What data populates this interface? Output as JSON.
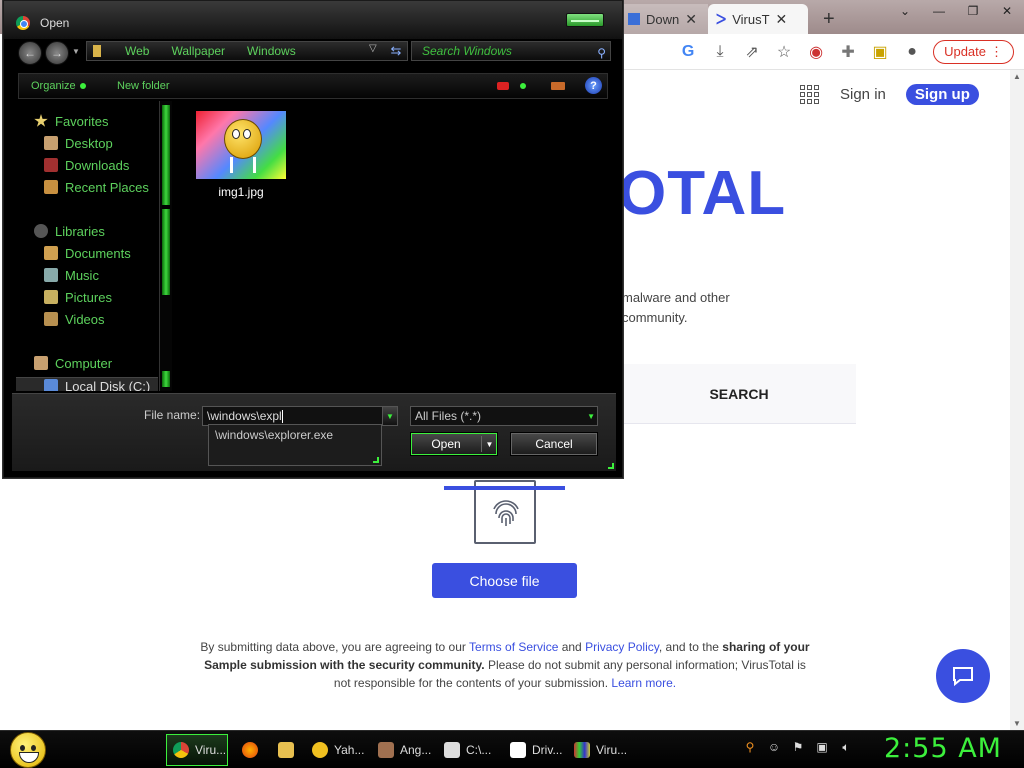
{
  "browser": {
    "tabs": [
      {
        "title": "Down"
      },
      {
        "title": "VirusT"
      }
    ],
    "new_tab": "+",
    "window_controls": {
      "minimize": "—",
      "maximize": "❐",
      "close": "✕"
    },
    "update_label": "Update",
    "colors": {
      "accent": "#3a4fe0",
      "update": "#d93025"
    }
  },
  "virustotal": {
    "sign_in": "Sign in",
    "sign_up": "Sign up",
    "logo_partial": "OTAL",
    "description_lines": [
      "malware and other",
      "community."
    ],
    "search_tab": "SEARCH",
    "choose_file": "Choose file",
    "legal": {
      "p1": "By submitting data above, you are agreeing to our ",
      "terms": "Terms of Service",
      "and": " and ",
      "privacy": "Privacy Policy",
      "p2": ", and to the ",
      "bold1": "sharing of your Sample submission with the security community.",
      "p3": " Please do not submit any personal information; VirusTotal is not responsible for the contents of your submission. ",
      "learn": "Learn more."
    }
  },
  "dialog": {
    "title": "Open",
    "address": [
      "Web",
      "Wallpaper",
      "Windows"
    ],
    "search_placeholder": "Search Windows",
    "commands": {
      "organize": "Organize",
      "new_folder": "New folder",
      "help": "?"
    },
    "nav": {
      "favorites": "Favorites",
      "desktop": "Desktop",
      "downloads": "Downloads",
      "recent": "Recent Places",
      "libraries": "Libraries",
      "documents": "Documents",
      "music": "Music",
      "pictures": "Pictures",
      "videos": "Videos",
      "computer": "Computer",
      "local_disk": "Local Disk (C:)"
    },
    "files": [
      {
        "name": "img1.jpg"
      }
    ],
    "file_name_label": "File name:",
    "file_name_value": "\\windows\\expl",
    "autocomplete": "\\windows\\explorer.exe",
    "file_type": "All Files (*.*)",
    "open": "Open",
    "cancel": "Cancel",
    "colors": {
      "theme_green": "#3cf03c",
      "text_green": "#5dd15d"
    }
  },
  "taskbar": {
    "items": [
      {
        "label": "Viru..."
      },
      {
        "label": ""
      },
      {
        "label": ""
      },
      {
        "label": "Yah..."
      },
      {
        "label": "Ang..."
      },
      {
        "label": "C:\\..."
      },
      {
        "label": "Driv..."
      },
      {
        "label": "Viru..."
      }
    ],
    "clock": "2:55 AM"
  }
}
